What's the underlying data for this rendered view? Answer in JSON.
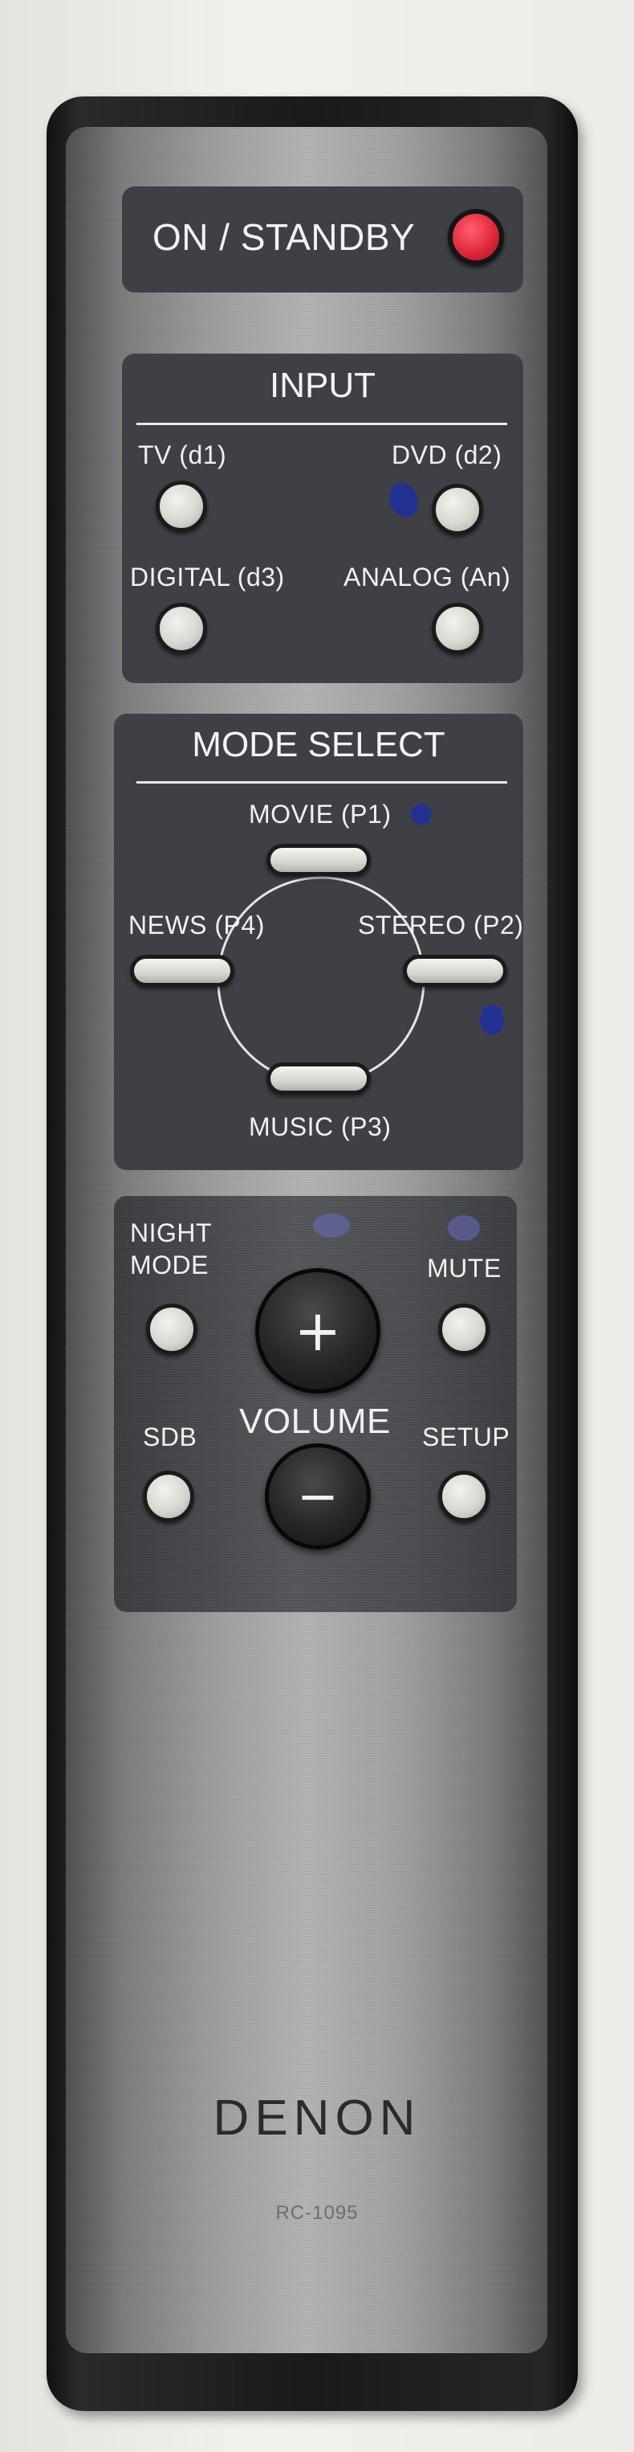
{
  "power": {
    "label": "ON / STANDBY"
  },
  "input": {
    "title": "INPUT",
    "buttons": [
      {
        "label": "TV (d1)"
      },
      {
        "label": "DVD (d2)"
      },
      {
        "label": "DIGITAL (d3)"
      },
      {
        "label": "ANALOG (An)"
      }
    ]
  },
  "mode_select": {
    "title": "MODE SELECT",
    "buttons": [
      {
        "label": "MOVIE (P1)"
      },
      {
        "label": "NEWS (P4)"
      },
      {
        "label": "STEREO (P2)"
      },
      {
        "label": "MUSIC (P3)"
      }
    ]
  },
  "controls": {
    "night_mode_line1": "NIGHT",
    "night_mode_line2": "MODE",
    "mute": "MUTE",
    "sdb": "SDB",
    "setup": "SETUP",
    "volume": "VOLUME",
    "vol_up_symbol": "+",
    "vol_down_symbol": "−"
  },
  "brand": {
    "name": "DENON",
    "model": "RC-1095"
  },
  "colors": {
    "standby_button": "#e0283a",
    "panel": "#3e4045",
    "pen_marks": "#1d2fa0"
  }
}
